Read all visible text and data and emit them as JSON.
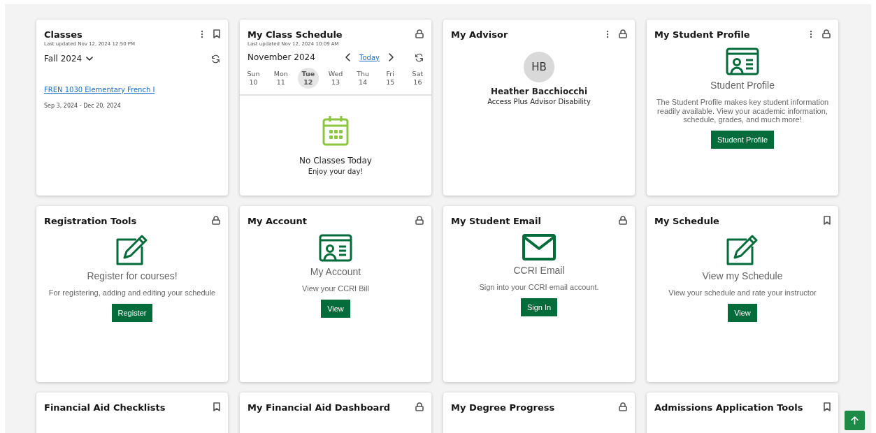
{
  "cards": [
    {
      "kind": "classes",
      "title": "Classes",
      "updated": "Last updated Nov 12, 2024 12:50 PM",
      "menu": true,
      "locked": false,
      "term": "Fall 2024",
      "course": "FREN 1030 Elementary French I",
      "dates": "Sep 3, 2024 - Dec 20, 2024"
    },
    {
      "kind": "schedule",
      "title": "My Class Schedule",
      "updated": "Last updated Nov 12, 2024 10:09 AM",
      "menu": false,
      "locked": true,
      "month": "November 2024",
      "today": "Today",
      "days": [
        {
          "name": "Sun",
          "date": "10",
          "selected": false
        },
        {
          "name": "Mon",
          "date": "11",
          "selected": false
        },
        {
          "name": "Tue",
          "date": "12",
          "selected": true
        },
        {
          "name": "Wed",
          "date": "13",
          "selected": false
        },
        {
          "name": "Thu",
          "date": "14",
          "selected": false
        },
        {
          "name": "Fri",
          "date": "15",
          "selected": false
        },
        {
          "name": "Sat",
          "date": "16",
          "selected": false
        }
      ],
      "empty_title": "No Classes Today",
      "empty_text": "Enjoy your day!"
    },
    {
      "kind": "advisor",
      "title": "My Advisor",
      "menu": true,
      "locked": true,
      "initials": "HB",
      "name": "Heather Bacchiocchi",
      "role": "Access Plus Advisor Disability"
    },
    {
      "kind": "id_link",
      "title": "My Student Profile",
      "menu": true,
      "locked": true,
      "heading": "Student Profile",
      "text": "The Student Profile makes key student information readily available. View your academic information, schedule, grades, and much more!",
      "button": "Student Profile"
    },
    {
      "kind": "edit_link",
      "title": "Registration Tools",
      "menu": false,
      "locked": true,
      "heading": "Register for courses!",
      "text": "For registering, adding and editing your schedule",
      "button": "Register"
    },
    {
      "kind": "id_link",
      "title": "My Account",
      "menu": false,
      "locked": true,
      "heading": "My Account",
      "text": "View your CCRI Bill",
      "button": "View"
    },
    {
      "kind": "mail_link",
      "title": "My Student Email",
      "menu": false,
      "locked": true,
      "heading": "CCRI Email",
      "text": "Sign into your CCRI email account.",
      "button": "Sign In"
    },
    {
      "kind": "edit_link",
      "title": "My Schedule",
      "menu": false,
      "locked": false,
      "heading": "View my Schedule",
      "text": "View your schedule and rate your instructor",
      "button": "View"
    },
    {
      "kind": "empty",
      "title": "Financial Aid Checklists",
      "menu": false,
      "locked": false
    },
    {
      "kind": "empty",
      "title": "My Financial Aid Dashboard",
      "menu": false,
      "locked": true
    },
    {
      "kind": "empty",
      "title": "My Degree Progress",
      "menu": false,
      "locked": true
    },
    {
      "kind": "empty",
      "title": "Admissions Application Tools",
      "menu": false,
      "locked": false
    }
  ]
}
